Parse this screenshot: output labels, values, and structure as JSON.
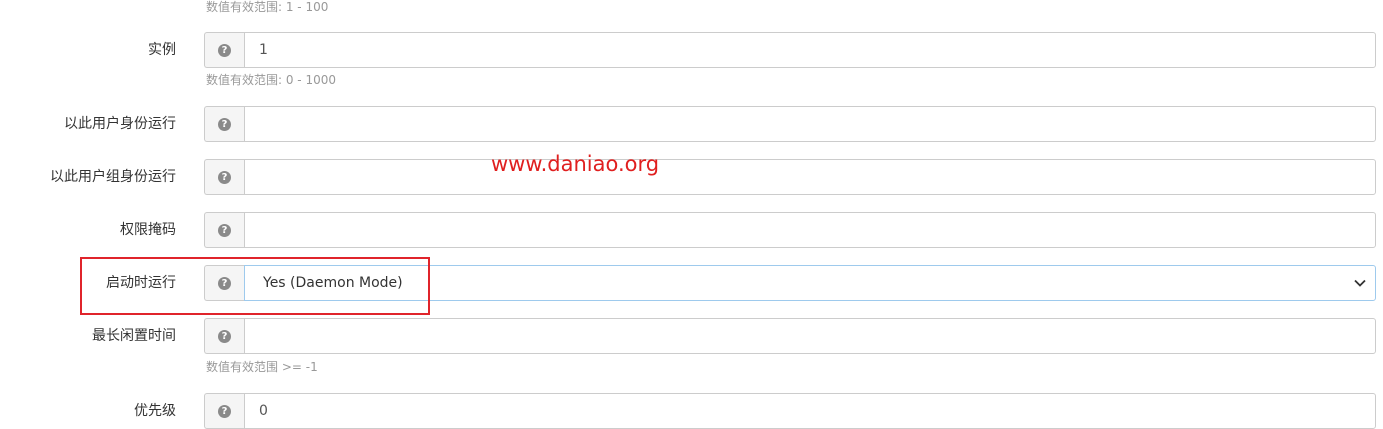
{
  "form": {
    "top_help": "数值有效范围: 1 - 100",
    "fields": [
      {
        "label": "实例",
        "value": "1",
        "help": "数值有效范围: 0 - 1000"
      },
      {
        "label": "以此用户身份运行",
        "value": ""
      },
      {
        "label": "以此用户组身份运行",
        "value": ""
      },
      {
        "label": "权限掩码",
        "value": ""
      },
      {
        "label": "启动时运行",
        "value": "Yes (Daemon Mode)"
      },
      {
        "label": "最长闲置时间",
        "value": "",
        "help": "数值有效范围 >= -1"
      },
      {
        "label": "优先级",
        "value": "0"
      }
    ]
  },
  "watermark": "www.daniao.org",
  "icons": {
    "help": "question-circle-icon",
    "dropdown": "chevron-down-icon"
  },
  "colors": {
    "highlight": "#e0242b",
    "watermark": "#e01f1f"
  }
}
